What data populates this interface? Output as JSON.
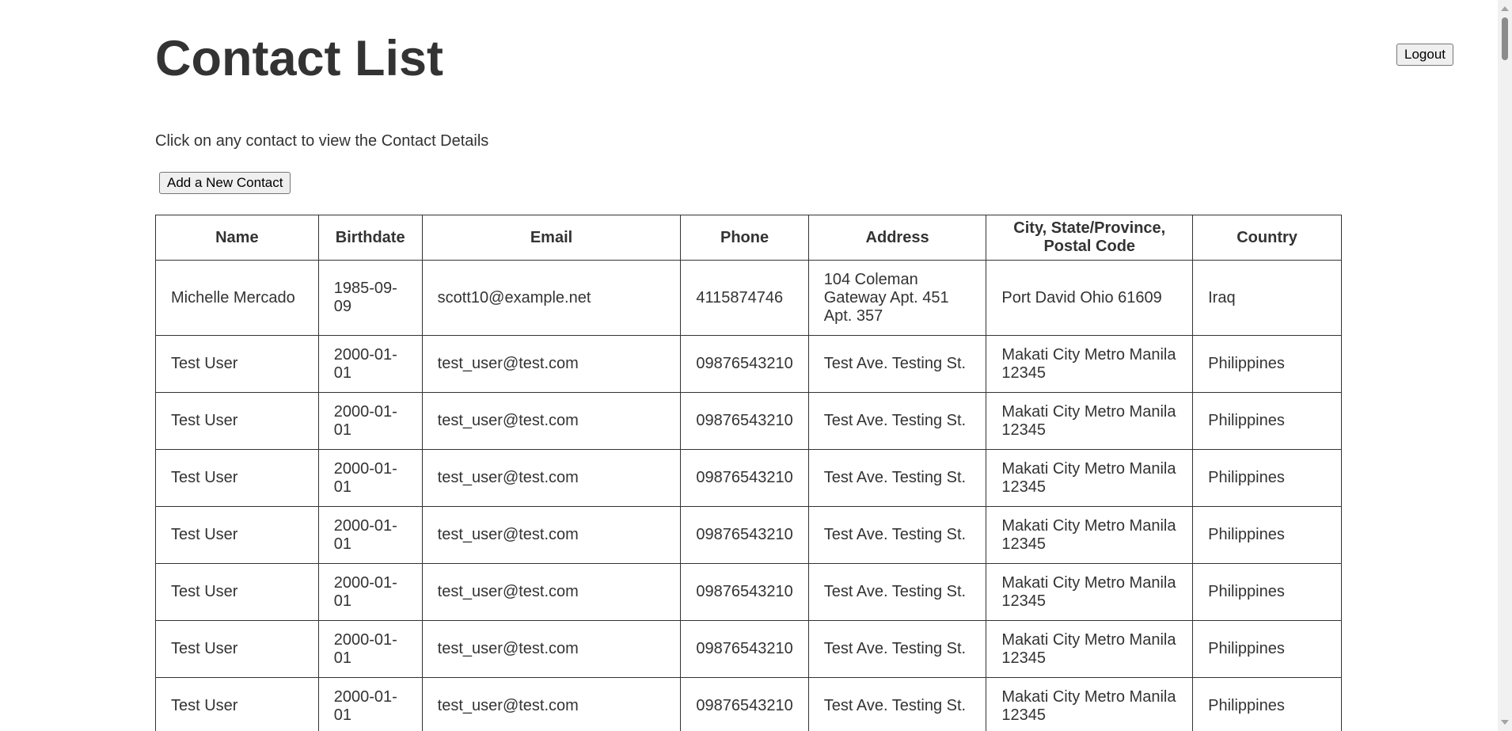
{
  "header": {
    "title": "Contact List",
    "logout_label": "Logout"
  },
  "instructions": "Click on any contact to view the Contact Details",
  "add_contact_label": "Add a New Contact",
  "table": {
    "columns": [
      "Name",
      "Birthdate",
      "Email",
      "Phone",
      "Address",
      "City, State/Province, Postal Code",
      "Country"
    ],
    "rows": [
      [
        "Michelle Mercado",
        "1985-09-09",
        "scott10@example.net",
        "4115874746",
        "104 Coleman Gateway Apt. 451 Apt. 357",
        "Port David Ohio 61609",
        "Iraq"
      ],
      [
        "Test User",
        "2000-01-01",
        "test_user@test.com",
        "09876543210",
        "Test Ave. Testing St.",
        "Makati City Metro Manila 12345",
        "Philippines"
      ],
      [
        "Test User",
        "2000-01-01",
        "test_user@test.com",
        "09876543210",
        "Test Ave. Testing St.",
        "Makati City Metro Manila 12345",
        "Philippines"
      ],
      [
        "Test User",
        "2000-01-01",
        "test_user@test.com",
        "09876543210",
        "Test Ave. Testing St.",
        "Makati City Metro Manila 12345",
        "Philippines"
      ],
      [
        "Test User",
        "2000-01-01",
        "test_user@test.com",
        "09876543210",
        "Test Ave. Testing St.",
        "Makati City Metro Manila 12345",
        "Philippines"
      ],
      [
        "Test User",
        "2000-01-01",
        "test_user@test.com",
        "09876543210",
        "Test Ave. Testing St.",
        "Makati City Metro Manila 12345",
        "Philippines"
      ],
      [
        "Test User",
        "2000-01-01",
        "test_user@test.com",
        "09876543210",
        "Test Ave. Testing St.",
        "Makati City Metro Manila 12345",
        "Philippines"
      ],
      [
        "Test User",
        "2000-01-01",
        "test_user@test.com",
        "09876543210",
        "Test Ave. Testing St.",
        "Makati City Metro Manila 12345",
        "Philippines"
      ]
    ]
  }
}
